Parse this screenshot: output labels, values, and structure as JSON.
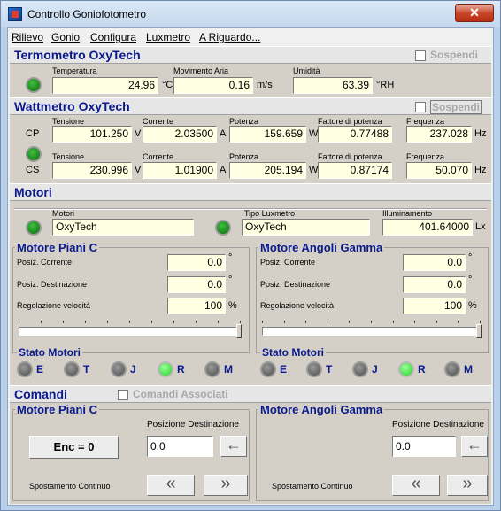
{
  "window": {
    "title": "Controllo Goniofotometro",
    "close_glyph": "✕"
  },
  "menu": [
    "Rilievo",
    "Gonio",
    "Configura",
    "Luxmetro",
    "A Riguardo..."
  ],
  "termometro": {
    "title": "Termometro  OxyTech",
    "sospendi": "Sospendi",
    "labels": {
      "temp": "Temperatura",
      "aria": "Movimento Aria",
      "umid": "Umidità"
    },
    "values": {
      "temp": "24.96",
      "aria": "0.16",
      "umid": "63.39"
    },
    "units": {
      "temp": "°C",
      "aria": "m/s",
      "umid": "°RH"
    }
  },
  "wattmetro": {
    "title": "Wattmetro  OxyTech",
    "sospendi": "Sospendi",
    "labels": {
      "tensione": "Tensione",
      "corrente": "Corrente",
      "potenza": "Potenza",
      "fattore": "Fattore di potenza",
      "frequenza": "Frequenza"
    },
    "cp": {
      "tag": "CP",
      "tensione": "101.250",
      "corrente": "2.03500",
      "potenza": "159.659",
      "fattore": "0.77488",
      "frequenza": "237.028"
    },
    "cs": {
      "tag": "CS",
      "tensione": "230.996",
      "corrente": "1.01900",
      "potenza": "205.194",
      "fattore": "0.87174",
      "frequenza": "50.070"
    },
    "units": {
      "v": "V",
      "a": "A",
      "w": "W",
      "hz": "Hz"
    }
  },
  "motori": {
    "title": "Motori",
    "labels": {
      "motori": "Motori",
      "tipo": "Tipo Luxmetro",
      "illum": "Illuminamento"
    },
    "values": {
      "motori": "OxyTech",
      "tipo": "OxyTech",
      "illum": "401.64000"
    },
    "units": {
      "illum": "Lx"
    }
  },
  "piani": {
    "title": "Motore Piani C",
    "corrente_label": "Posiz. Corrente",
    "corrente": "0.0",
    "corrente_unit": "°",
    "dest_label": "Posiz. Destinazione",
    "dest": "0.0",
    "dest_unit": "°",
    "vel_label": "Regolazione velocità",
    "vel": "100",
    "vel_unit": "%",
    "slider_level": 1.0
  },
  "gamma": {
    "title": "Motore Angoli Gamma",
    "corrente_label": "Posiz. Corrente",
    "corrente": "0.0",
    "corrente_unit": "°",
    "dest_label": "Posiz. Destinazione",
    "dest": "0.0",
    "dest_unit": "°",
    "vel_label": "Regolazione velocità",
    "vel": "100",
    "vel_unit": "%",
    "slider_level": 1.0
  },
  "stato": {
    "title": "Stato Motori",
    "leds": [
      "E",
      "T",
      "J",
      "R",
      "M"
    ],
    "lit": "R"
  },
  "comandi": {
    "title": "Comandi",
    "associati": "Comandi Associati",
    "piani": {
      "title": "Motore Piani C",
      "pos_label": "Posizione Destinazione",
      "enc": "Enc = 0",
      "pos_value": "0.0",
      "apply": "←",
      "cont": "Spostamento Continuo",
      "left": "«",
      "right": "»"
    },
    "gamma": {
      "title": "Motore Angoli Gamma",
      "pos_label": "Posizione Destinazione",
      "pos_value": "0.0",
      "apply": "←",
      "cont": "Spostamento Continuo",
      "left": "«",
      "right": "»"
    }
  },
  "colors": {
    "title_blue": "#0a1a8c",
    "field_bg": "#ffffe1",
    "led_green": "#1e8f1e",
    "led_lit": "#5cff5c",
    "close_red": "#c7452a"
  }
}
